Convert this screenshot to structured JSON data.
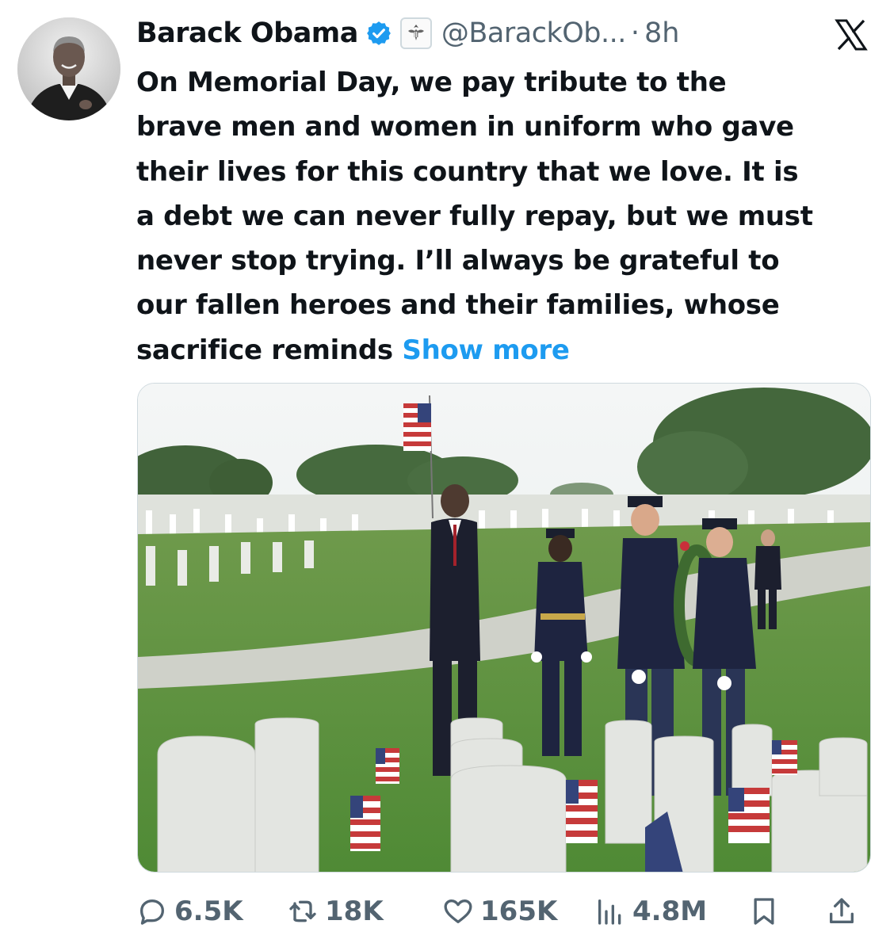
{
  "author": {
    "name": "Barack Obama",
    "handle": "@BarackOb...",
    "separator": "·",
    "time": "8h"
  },
  "tweet": {
    "lines": [
      "On Memorial Day, we pay tribute to the",
      "brave men and women in uniform who gave",
      "their lives for this country that we love. It is",
      "a debt we can never fully repay, but we must",
      "never stop trying. I’ll always be grateful to",
      "our fallen heroes and their families, whose",
      "sacrifice reminds "
    ],
    "show_more": "Show more"
  },
  "actions": {
    "replies": "6.5K",
    "reposts": "18K",
    "likes": "165K",
    "views": "4.8M"
  },
  "icons": {
    "verified": "verified-badge-icon",
    "affiliation": "us-seal-icon",
    "platform": "x-logo-icon",
    "reply": "reply-bubble-icon",
    "repost": "repost-icon",
    "like": "heart-icon",
    "views": "bar-chart-icon",
    "bookmark": "bookmark-icon",
    "share": "share-icon"
  },
  "colors": {
    "accent": "#1d9bf0",
    "text": "#0f1419",
    "muted": "#536471"
  }
}
